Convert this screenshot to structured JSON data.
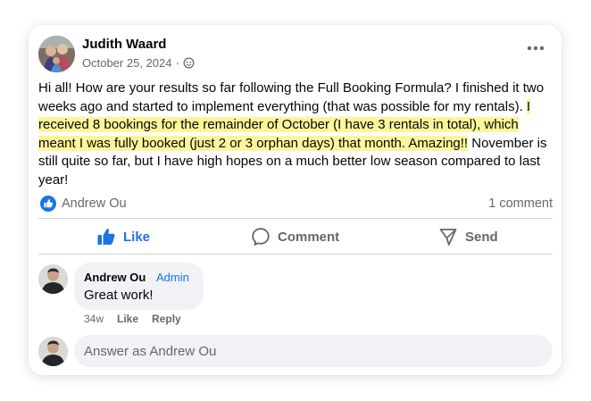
{
  "post": {
    "author": "Judith Waard",
    "date": "October 25, 2024",
    "separator": "·",
    "text_intro": "Hi all! How are your results so far following the Full Booking Formula? I finished it two weeks ago and started to implement everything (that was possible for my rentals). ",
    "text_highlight": "I received 8 bookings for the remainder of October (I have 3 rentals in total), which meant I was fully booked (just 2 or 3 orphan days) that month. Amazing!!",
    "text_outro": " November is still quite so far, but I have high hopes on a much better low season compared to last year!",
    "highlight_color": "#fdf59a"
  },
  "reactions": {
    "name": "Andrew Ou",
    "comment_count": "1 comment"
  },
  "actions": {
    "like": "Like",
    "comment": "Comment",
    "send": "Send"
  },
  "comment": {
    "author": "Andrew Ou",
    "badge": "Admin",
    "text": "Great work!",
    "age": "34w",
    "like": "Like",
    "reply": "Reply"
  },
  "reply_input": {
    "placeholder": "Answer as Andrew Ou"
  },
  "icons": {
    "more": "more-horizontal-icon",
    "audience": "globe-icon",
    "like_badge": "thumbs-up-icon",
    "comment": "speech-bubble-icon",
    "send": "send-icon"
  },
  "colors": {
    "accent": "#1b74e4",
    "secondary_text": "#65676b",
    "bubble": "#f0f2f5"
  }
}
